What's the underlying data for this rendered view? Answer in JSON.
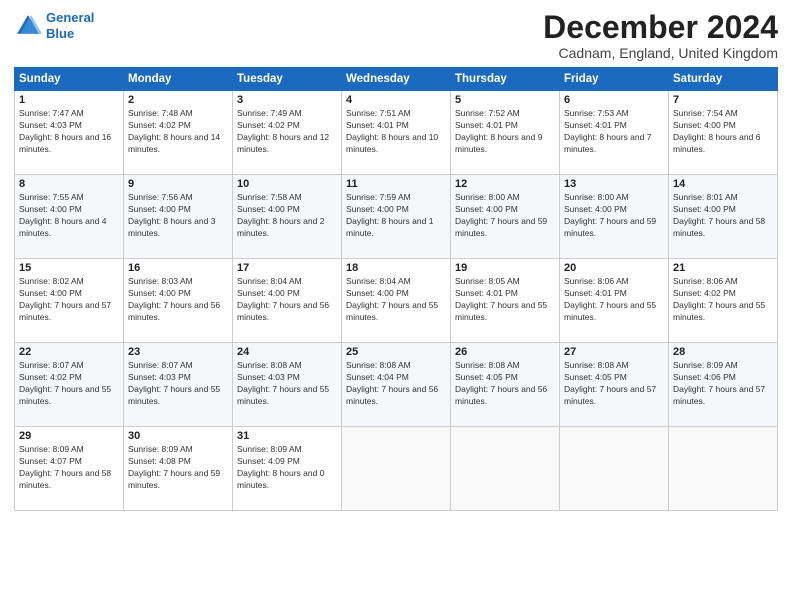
{
  "header": {
    "logo_line1": "General",
    "logo_line2": "Blue",
    "month_title": "December 2024",
    "location": "Cadnam, England, United Kingdom"
  },
  "weekdays": [
    "Sunday",
    "Monday",
    "Tuesday",
    "Wednesday",
    "Thursday",
    "Friday",
    "Saturday"
  ],
  "weeks": [
    [
      {
        "day": "1",
        "rise": "7:47 AM",
        "set": "4:03 PM",
        "daylight": "8 hours and 16 minutes."
      },
      {
        "day": "2",
        "rise": "7:48 AM",
        "set": "4:02 PM",
        "daylight": "8 hours and 14 minutes."
      },
      {
        "day": "3",
        "rise": "7:49 AM",
        "set": "4:02 PM",
        "daylight": "8 hours and 12 minutes."
      },
      {
        "day": "4",
        "rise": "7:51 AM",
        "set": "4:01 PM",
        "daylight": "8 hours and 10 minutes."
      },
      {
        "day": "5",
        "rise": "7:52 AM",
        "set": "4:01 PM",
        "daylight": "8 hours and 9 minutes."
      },
      {
        "day": "6",
        "rise": "7:53 AM",
        "set": "4:01 PM",
        "daylight": "8 hours and 7 minutes."
      },
      {
        "day": "7",
        "rise": "7:54 AM",
        "set": "4:00 PM",
        "daylight": "8 hours and 6 minutes."
      }
    ],
    [
      {
        "day": "8",
        "rise": "7:55 AM",
        "set": "4:00 PM",
        "daylight": "8 hours and 4 minutes."
      },
      {
        "day": "9",
        "rise": "7:56 AM",
        "set": "4:00 PM",
        "daylight": "8 hours and 3 minutes."
      },
      {
        "day": "10",
        "rise": "7:58 AM",
        "set": "4:00 PM",
        "daylight": "8 hours and 2 minutes."
      },
      {
        "day": "11",
        "rise": "7:59 AM",
        "set": "4:00 PM",
        "daylight": "8 hours and 1 minute."
      },
      {
        "day": "12",
        "rise": "8:00 AM",
        "set": "4:00 PM",
        "daylight": "7 hours and 59 minutes."
      },
      {
        "day": "13",
        "rise": "8:00 AM",
        "set": "4:00 PM",
        "daylight": "7 hours and 59 minutes."
      },
      {
        "day": "14",
        "rise": "8:01 AM",
        "set": "4:00 PM",
        "daylight": "7 hours and 58 minutes."
      }
    ],
    [
      {
        "day": "15",
        "rise": "8:02 AM",
        "set": "4:00 PM",
        "daylight": "7 hours and 57 minutes."
      },
      {
        "day": "16",
        "rise": "8:03 AM",
        "set": "4:00 PM",
        "daylight": "7 hours and 56 minutes."
      },
      {
        "day": "17",
        "rise": "8:04 AM",
        "set": "4:00 PM",
        "daylight": "7 hours and 56 minutes."
      },
      {
        "day": "18",
        "rise": "8:04 AM",
        "set": "4:00 PM",
        "daylight": "7 hours and 55 minutes."
      },
      {
        "day": "19",
        "rise": "8:05 AM",
        "set": "4:01 PM",
        "daylight": "7 hours and 55 minutes."
      },
      {
        "day": "20",
        "rise": "8:06 AM",
        "set": "4:01 PM",
        "daylight": "7 hours and 55 minutes."
      },
      {
        "day": "21",
        "rise": "8:06 AM",
        "set": "4:02 PM",
        "daylight": "7 hours and 55 minutes."
      }
    ],
    [
      {
        "day": "22",
        "rise": "8:07 AM",
        "set": "4:02 PM",
        "daylight": "7 hours and 55 minutes."
      },
      {
        "day": "23",
        "rise": "8:07 AM",
        "set": "4:03 PM",
        "daylight": "7 hours and 55 minutes."
      },
      {
        "day": "24",
        "rise": "8:08 AM",
        "set": "4:03 PM",
        "daylight": "7 hours and 55 minutes."
      },
      {
        "day": "25",
        "rise": "8:08 AM",
        "set": "4:04 PM",
        "daylight": "7 hours and 56 minutes."
      },
      {
        "day": "26",
        "rise": "8:08 AM",
        "set": "4:05 PM",
        "daylight": "7 hours and 56 minutes."
      },
      {
        "day": "27",
        "rise": "8:08 AM",
        "set": "4:05 PM",
        "daylight": "7 hours and 57 minutes."
      },
      {
        "day": "28",
        "rise": "8:09 AM",
        "set": "4:06 PM",
        "daylight": "7 hours and 57 minutes."
      }
    ],
    [
      {
        "day": "29",
        "rise": "8:09 AM",
        "set": "4:07 PM",
        "daylight": "7 hours and 58 minutes."
      },
      {
        "day": "30",
        "rise": "8:09 AM",
        "set": "4:08 PM",
        "daylight": "7 hours and 59 minutes."
      },
      {
        "day": "31",
        "rise": "8:09 AM",
        "set": "4:09 PM",
        "daylight": "8 hours and 0 minutes."
      },
      null,
      null,
      null,
      null
    ]
  ]
}
